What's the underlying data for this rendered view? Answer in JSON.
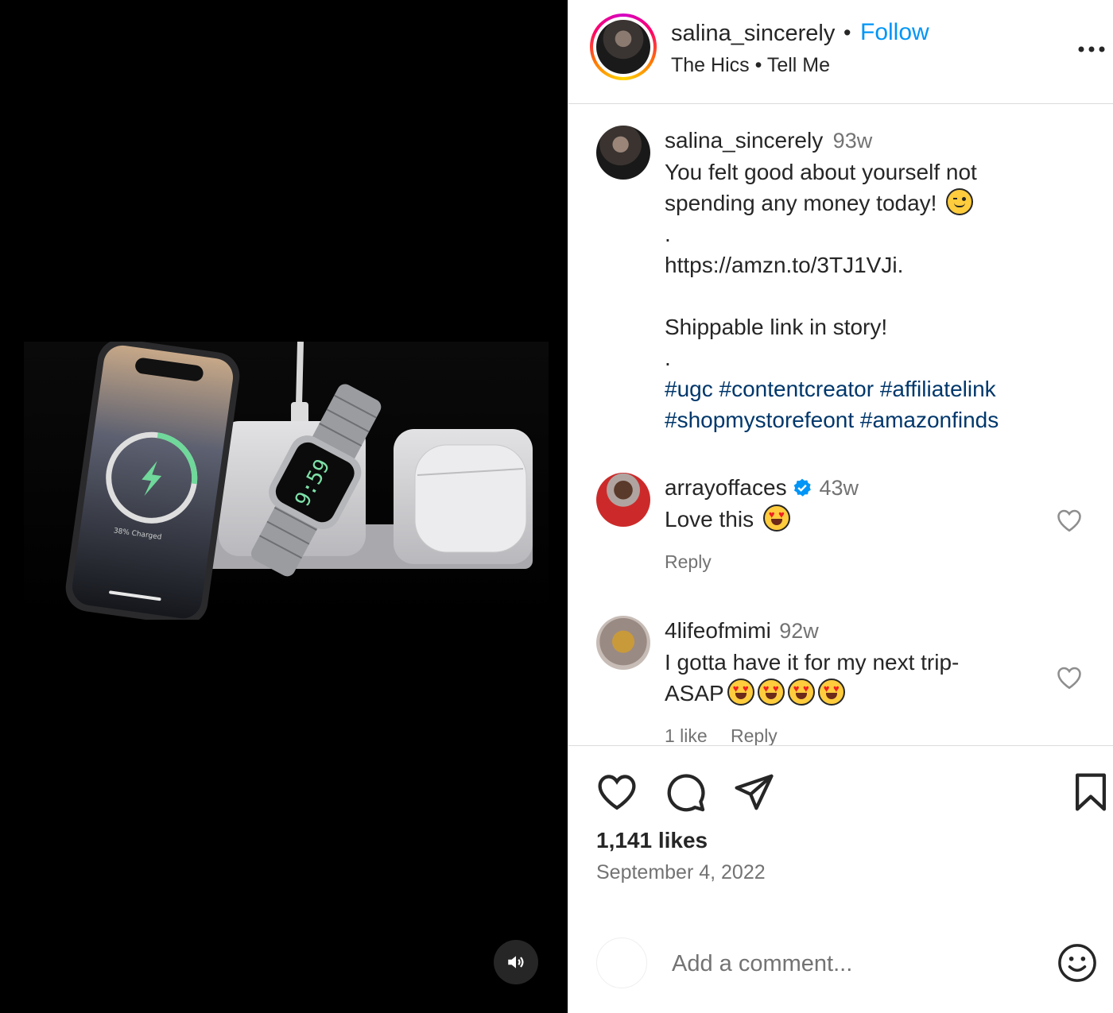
{
  "header": {
    "username": "salina_sincerely",
    "separator": "•",
    "follow_label": "Follow",
    "audio": "The Hics • Tell Me"
  },
  "caption": {
    "username": "salina_sincerely",
    "time": "93w",
    "line1": "You felt good about yourself not",
    "line2": "spending any money today!",
    "dot1": ".",
    "link": "https://amzn.to/3TJ1VJi.",
    "line3": "Shippable link in story!",
    "dot2": ".",
    "hashtags": [
      "#ugc",
      "#contentcreator",
      "#affiliatelink",
      "#shopmystorefeont",
      "#amazonfinds"
    ]
  },
  "comments": [
    {
      "username": "arrayoffaces",
      "verified": true,
      "time": "43w",
      "text": "Love this",
      "reply_label": "Reply"
    },
    {
      "username": "4lifeofmimi",
      "time": "92w",
      "text_line1": "I gotta have it for my next trip-",
      "text_line2": "ASAP",
      "likes_label": "1 like",
      "reply_label": "Reply"
    }
  ],
  "post": {
    "likes": "1,141 likes",
    "date": "September 4, 2022"
  },
  "add_comment": {
    "placeholder": "Add a comment..."
  },
  "media": {
    "phone_status": "38% Charged",
    "watch_time": "9:59"
  },
  "colors": {
    "link_blue": "#0095f6",
    "hashtag": "#00376b",
    "secondary": "#737373",
    "verified": "#0095f6"
  },
  "icons": [
    "more-icon",
    "heart-icon",
    "comment-icon",
    "share-icon",
    "bookmark-icon",
    "smile-icon",
    "volume-icon",
    "verified-icon"
  ]
}
